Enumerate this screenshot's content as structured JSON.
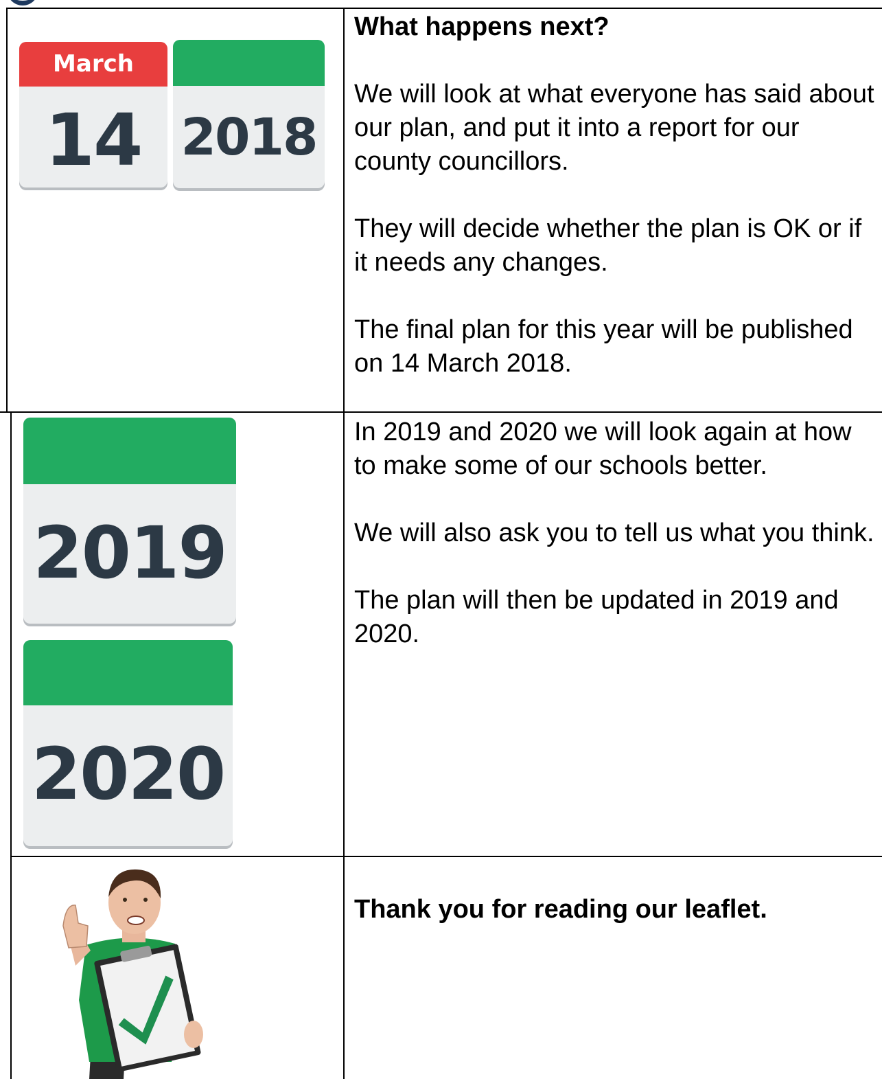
{
  "calendars": {
    "first": {
      "month": "March",
      "day": "14"
    },
    "second": {
      "year": "2018"
    },
    "third": {
      "year": "2019"
    },
    "fourth": {
      "year": "2020"
    }
  },
  "row1": {
    "heading": "What happens next?",
    "paragraphs": [
      "We will look at what everyone has said about our plan, and put it into a report for our county councillors.",
      "They will decide whether the plan is OK or if it needs any changes.",
      "The final plan for this year will be published on 14 March 2018."
    ]
  },
  "row2": {
    "paragraphs": [
      "In 2019 and 2020 we will look again at how to make some of our schools better.",
      "We will also ask you to tell us what you think.",
      "The plan will then be updated in 2019 and 2020."
    ]
  },
  "row3": {
    "heading": "Thank you for reading our leaflet."
  },
  "colors": {
    "calendar_red": "#e83e3e",
    "calendar_green": "#22ac61",
    "calendar_text": "#2c3945",
    "check_green": "#1e8f4f"
  },
  "icons": [
    "calendar-icon",
    "person-thumbs-up-icon",
    "checkmark-icon"
  ]
}
